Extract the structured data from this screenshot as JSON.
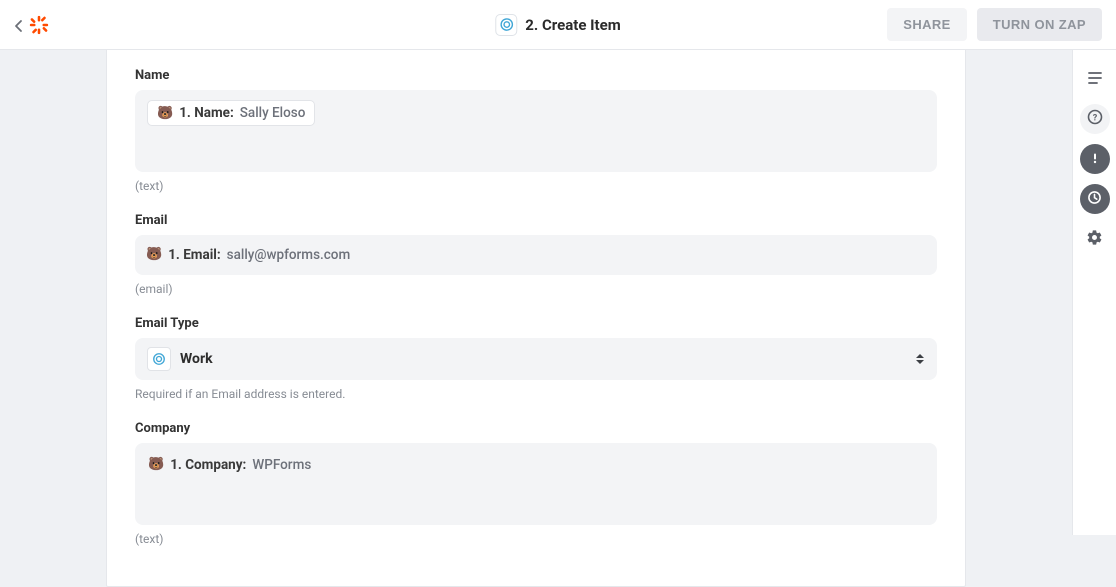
{
  "header": {
    "title": "2. Create Item",
    "share_label": "SHARE",
    "turn_on_label": "TURN ON ZAP"
  },
  "fields": {
    "name": {
      "label": "Name",
      "pill_label": "1. Name:",
      "pill_value": "Sally Eloso",
      "hint": "(text)"
    },
    "email": {
      "label": "Email",
      "pill_label": "1. Email:",
      "pill_value": "sally@wpforms.com",
      "hint": "(email)"
    },
    "email_type": {
      "label": "Email Type",
      "selected": "Work",
      "hint": "Required if an Email address is entered."
    },
    "company": {
      "label": "Company",
      "pill_label": "1. Company:",
      "pill_value": "WPForms",
      "hint": "(text)"
    }
  }
}
